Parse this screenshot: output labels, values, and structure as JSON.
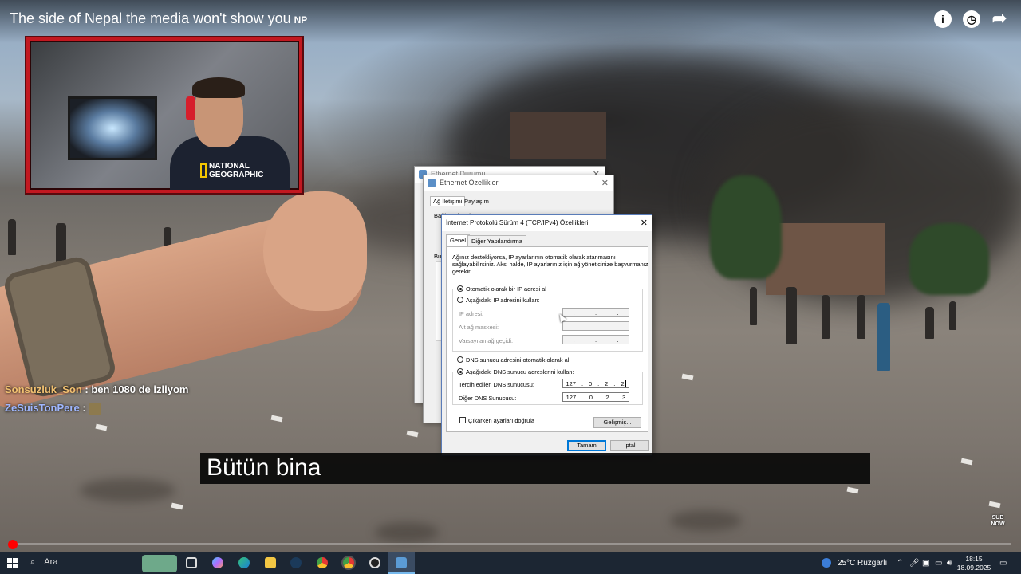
{
  "video": {
    "title": "The side of Nepal the media won't show you",
    "flag": "NP",
    "icons": [
      "info-icon",
      "clock-icon",
      "share-icon"
    ],
    "subtitle": "Bütün bina",
    "progress_percent": 0.6,
    "corner_badge": "SUB NOW"
  },
  "webcam": {
    "shirt_text_line1": "NATIONAL",
    "shirt_text_line2": "GEOGRAPHIC"
  },
  "chat": [
    {
      "user": "Sonsuzluk_Son",
      "message": ": ben 1080 de izliyom"
    },
    {
      "user": "ZeSuisTonPere",
      "message": ":"
    }
  ],
  "bg_windows": {
    "status_title": "Ethernet Durumu",
    "props_title": "Ethernet Özellikleri",
    "props_tab1": "Ağ İletişimi",
    "props_tab2": "Paylaşım",
    "props_text1": "Bağlantı kurulan:",
    "props_text2": "Bu"
  },
  "dialog": {
    "title": "İnternet Protokolü Sürüm 4 (TCP/IPv4) Özellikleri",
    "close": "✕",
    "tabs": [
      "Genel",
      "Diğer Yapılandırma"
    ],
    "description": [
      "Ağınız destekliyorsa, IP ayarlarının otomatik olarak atanmasını",
      "sağlayabilirsiniz. Aksi halde, IP ayarlarınız için ağ yöneticinize başvurmanız",
      "gerekir."
    ],
    "ip_auto": "Otomatik olarak bir IP adresi al",
    "ip_manual": "Aşağıdaki IP adresini kullan:",
    "ip_address_label": "IP adresi:",
    "subnet_label": "Alt ağ maskesi:",
    "gateway_label": "Varsayılan ağ geçidi:",
    "dns_auto": "DNS sunucu adresini otomatik olarak al",
    "dns_manual": "Aşağıdaki DNS sunucu adreslerini kullan:",
    "preferred_dns_label": "Tercih edilen DNS sunucusu:",
    "preferred_dns": [
      "127",
      "0",
      "2",
      "2"
    ],
    "alternate_dns_label": "Diğer DNS Sunucusu:",
    "alternate_dns": [
      "127",
      "0",
      "2",
      "3"
    ],
    "validate_label": "Çıkarken ayarları doğrula",
    "advanced_button": "Gelişmiş...",
    "ok_button": "Tamam",
    "cancel_button": "İptal"
  },
  "taskbar": {
    "search_placeholder": "Ara",
    "weather": "25°C",
    "weather_desc": "Rüzgarlı",
    "time": "18:15",
    "date": "18.09.2025"
  },
  "colors": {
    "progress": "#ff0000",
    "webcam_border": "#c21820",
    "taskbar": "#1c2633",
    "dialog_border": "#5a7cb8"
  }
}
